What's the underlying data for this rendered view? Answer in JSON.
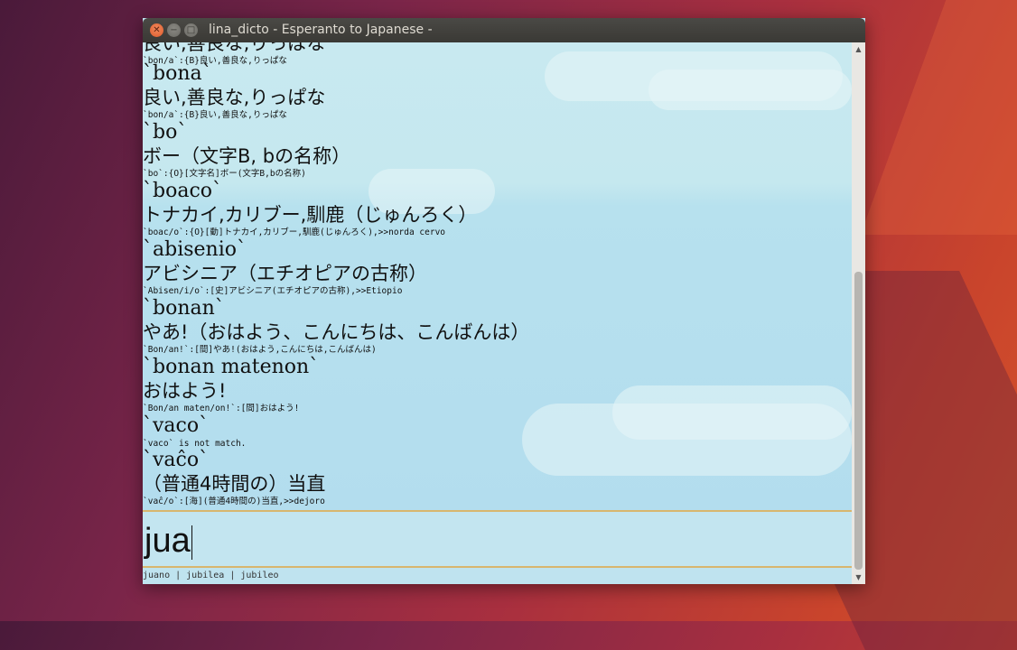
{
  "window": {
    "title": "lina_dicto - Esperanto to Japanese -",
    "close_symbol": "✕",
    "minimize_symbol": "−",
    "maximize_symbol": "□"
  },
  "results": [
    {
      "head": null,
      "trans": "良い,善良な,りっぱな",
      "raw": "`bon/a`:{B}良い,善良な,りっぱな"
    },
    {
      "head": "`bona`",
      "trans": "良い,善良な,りっぱな",
      "raw": "`bon/a`:{B}良い,善良な,りっぱな"
    },
    {
      "head": "`bo`",
      "trans": "ボー（文字B, bの名称）",
      "raw": "`bo`:{O}[文字名]ボー(文字B,bの名称)"
    },
    {
      "head": "`boaco`",
      "trans": "トナカイ,カリブー,馴鹿（じゅんろく）",
      "raw": "`boac/o`:{O}[動]トナカイ,カリブー,馴鹿(じゅんろく),>>norda cervo"
    },
    {
      "head": "`abisenio`",
      "trans": "アビシニア（エチオピアの古称）",
      "raw": "`Abisen/i/o`:[史]アビシニア(エチオピアの古称),>>Etiopio"
    },
    {
      "head": "`bonan`",
      "trans": "やあ!（おはよう、こんにちは、こんばんは）",
      "raw": "`Bon/an!`:[間]やあ!(おはよう,こんにちは,こんばんは)"
    },
    {
      "head": "`bonan matenon`",
      "trans": "おはよう!",
      "raw": "`Bon/an maten/on!`:[間]おはよう!"
    },
    {
      "head": "`vaco`",
      "trans": null,
      "raw": "`vaco` is not match."
    },
    {
      "head": "`vaĉo`",
      "trans": "（普通4時間の）当直",
      "raw": "`vaĉ/o`:[海](普通4時間の)当直,>>dejoro"
    }
  ],
  "input": {
    "value": "jua"
  },
  "suggestions": {
    "text": "juano | jubilea | jubileo"
  },
  "scrollbar": {
    "up_symbol": "▲",
    "down_symbol": "▼",
    "position": 0.82
  }
}
